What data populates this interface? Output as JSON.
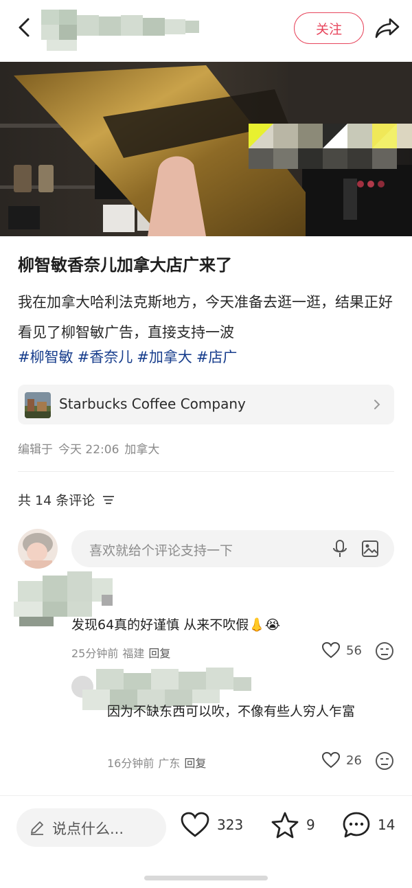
{
  "header": {
    "follow_label": "关注"
  },
  "post": {
    "title": "柳智敏香奈儿加拿大店广来了",
    "body": "我在加拿大哈利法克斯地方，今天准备去逛一逛，结果正好看见了柳智敏广告，直接支持一波",
    "tags": [
      "#柳智敏",
      "#香奈儿",
      "#加拿大",
      "#店广"
    ],
    "location": "Starbucks Coffee Company",
    "edited_label": "编辑于",
    "edited_time": "今天 22:06",
    "region": "加拿大"
  },
  "comments_section": {
    "count_label": "共 14 条评论",
    "input_placeholder": "喜欢就给个评论支持一下",
    "items": [
      {
        "text": "发现64真的好谨慎 从来不吹假👃😭",
        "time": "25分钟前",
        "region": "福建",
        "reply_label": "回复",
        "likes": "56"
      },
      {
        "text": "因为不缺东西可以吹，不像有些人穷人乍富",
        "time": "16分钟前",
        "region": "广东",
        "reply_label": "回复",
        "likes": "26"
      }
    ]
  },
  "bottom_bar": {
    "say_label": "说点什么...",
    "likes": "323",
    "favorites": "9",
    "comments": "14"
  },
  "colors": {
    "accent": "#e7455c",
    "tag": "#173d8c"
  }
}
